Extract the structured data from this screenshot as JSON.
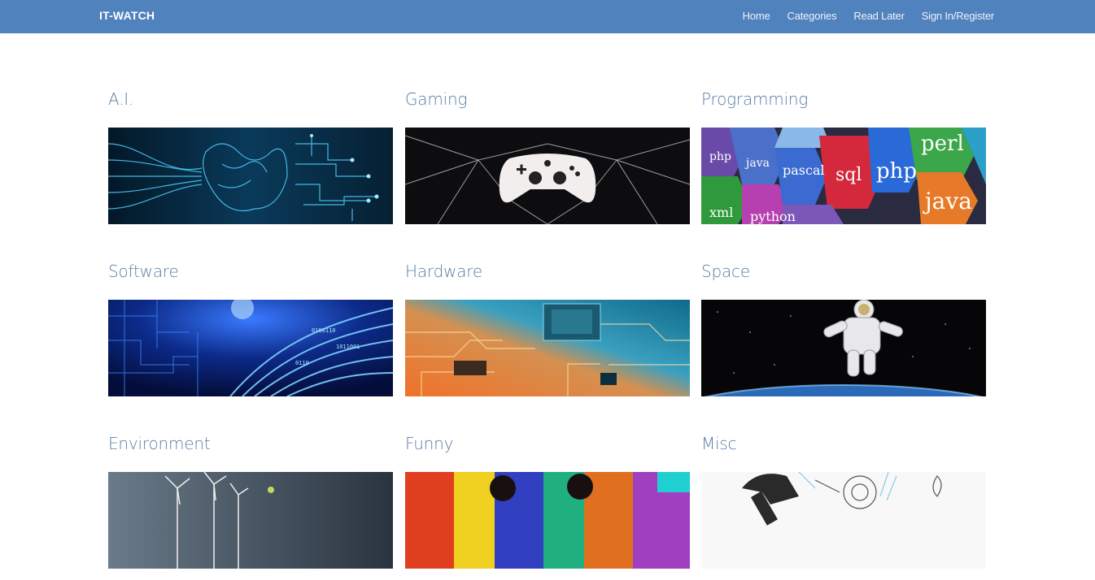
{
  "navbar": {
    "brand": "IT-WATCH",
    "links": [
      "Home",
      "Categories",
      "Read Later",
      "Sign In/Register"
    ]
  },
  "categories": [
    {
      "title": "A.I.",
      "image_icon": "ai-brain-circuit-image"
    },
    {
      "title": "Gaming",
      "image_icon": "game-controller-image"
    },
    {
      "title": "Programming",
      "image_icon": "programming-languages-image",
      "image_text": [
        "php",
        "java",
        "sql",
        "perl",
        "pascal",
        "xml",
        "python"
      ]
    },
    {
      "title": "Software",
      "image_icon": "binary-circuit-image"
    },
    {
      "title": "Hardware",
      "image_icon": "circuit-board-image"
    },
    {
      "title": "Space",
      "image_icon": "astronaut-image"
    },
    {
      "title": "Environment",
      "image_icon": "wind-turbines-image"
    },
    {
      "title": "Funny",
      "image_icon": "colorful-paint-image"
    },
    {
      "title": "Misc",
      "image_icon": "tools-sketch-image"
    }
  ],
  "colors": {
    "navbar_bg": "#5082bd",
    "title_text": "#5a7ea6"
  }
}
